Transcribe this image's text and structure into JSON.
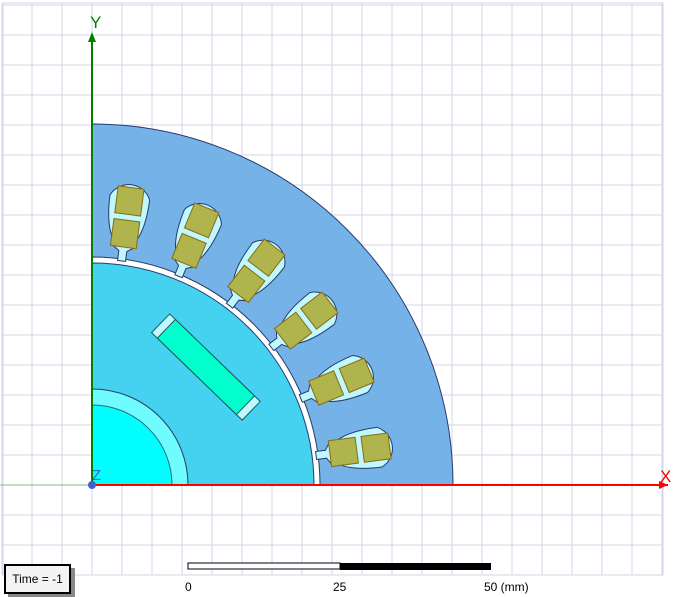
{
  "viewport": {
    "axes": {
      "x_label": "X",
      "y_label": "Y",
      "z_label": "Z"
    },
    "time_label": "Time = -1",
    "scale_bar": {
      "ticks": [
        "0",
        "25",
        "50 (mm)"
      ]
    },
    "model": {
      "slot_count_visible": 6,
      "magnet_count_visible": 1
    },
    "colors": {
      "stator": "#74b2e8",
      "rotor": "#44d2f0",
      "slot": "#bff8ff",
      "coil": "#b0b44c",
      "magnet": "#00ffcc",
      "shaft": "#00ffff",
      "sleeve": "#6ffcff",
      "x_axis": "#ff0000",
      "y_axis": "#008000",
      "grid": "#d6d6ea"
    }
  }
}
